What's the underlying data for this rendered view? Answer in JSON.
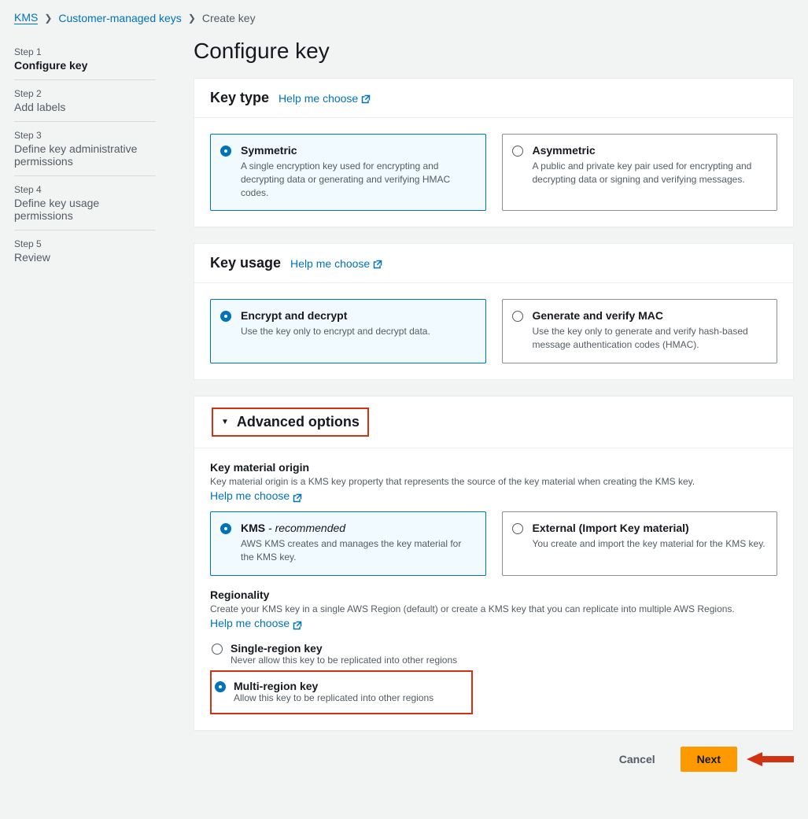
{
  "breadcrumb": {
    "items": [
      {
        "label": "KMS",
        "link": true
      },
      {
        "label": "Customer-managed keys",
        "link": true
      },
      {
        "label": "Create key",
        "link": false
      }
    ]
  },
  "sidebar": {
    "steps": [
      {
        "label": "Step 1",
        "title": "Configure key",
        "active": true
      },
      {
        "label": "Step 2",
        "title": "Add labels",
        "active": false
      },
      {
        "label": "Step 3",
        "title": "Define key administrative permissions",
        "active": false
      },
      {
        "label": "Step 4",
        "title": "Define key usage permissions",
        "active": false
      },
      {
        "label": "Step 5",
        "title": "Review",
        "active": false
      }
    ]
  },
  "page": {
    "title": "Configure key"
  },
  "key_type": {
    "heading": "Key type",
    "help": "Help me choose",
    "options": [
      {
        "title": "Symmetric",
        "desc": "A single encryption key used for encrypting and decrypting data or generating and verifying HMAC codes.",
        "selected": true
      },
      {
        "title": "Asymmetric",
        "desc": "A public and private key pair used for encrypting and decrypting data or signing and verifying messages.",
        "selected": false
      }
    ]
  },
  "key_usage": {
    "heading": "Key usage",
    "help": "Help me choose",
    "options": [
      {
        "title": "Encrypt and decrypt",
        "desc": "Use the key only to encrypt and decrypt data.",
        "selected": true
      },
      {
        "title": "Generate and verify MAC",
        "desc": "Use the key only to generate and verify hash-based message authentication codes (HMAC).",
        "selected": false
      }
    ]
  },
  "advanced": {
    "heading": "Advanced options",
    "origin": {
      "label": "Key material origin",
      "hint_pre": "Key material origin is a KMS key property that represents the source of the key material when creating the KMS key. ",
      "help": "Help me choose",
      "options": [
        {
          "title": "KMS",
          "rec": " - recommended",
          "desc": "AWS KMS creates and manages the key material for the KMS key.",
          "selected": true
        },
        {
          "title": "External (Import Key material)",
          "desc": "You create and import the key material for the KMS key.",
          "selected": false
        }
      ]
    },
    "regionality": {
      "label": "Regionality",
      "hint_pre": "Create your KMS key in a single AWS Region (default) or create a KMS key that you can replicate into multiple AWS Regions. ",
      "help": "Help me choose",
      "options": [
        {
          "title": "Single-region key",
          "desc": "Never allow this key to be replicated into other regions",
          "selected": false
        },
        {
          "title": "Multi-region key",
          "desc": "Allow this key to be replicated into other regions",
          "selected": true
        }
      ]
    }
  },
  "footer": {
    "cancel": "Cancel",
    "next": "Next"
  }
}
